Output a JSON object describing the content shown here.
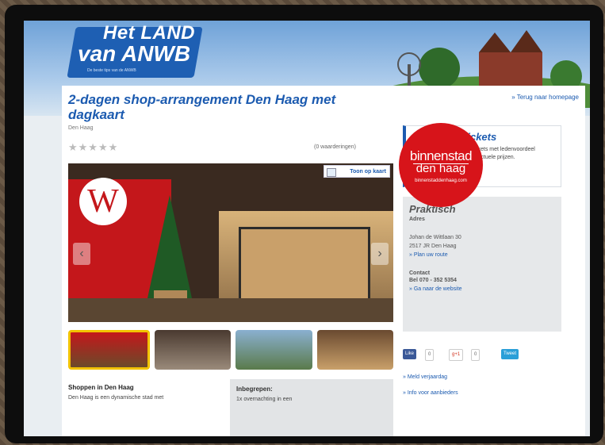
{
  "logo": {
    "line1": "Het LAND",
    "line2": "van ANWB",
    "tagline": "De beste tips van de ANWB"
  },
  "badge": {
    "line1": "binnenstad",
    "line2": "den haag",
    "url": "binnenstaddenhaag.com"
  },
  "page": {
    "title": "2-dagen shop-arrangement Den Haag met dagkaart",
    "back_link": "» Terug naar homepage",
    "location": "Den Haag",
    "stars": "★★★★★",
    "reviews": "(0 waarderingen)",
    "map_button": "Toon op kaart",
    "shop_title": "Shoppen in Den Haag",
    "shop_text": "Den Haag is een dynamische stad met",
    "incl_title": "Inbegrepen:",
    "incl_text": "1x overnachting in een"
  },
  "sidebar": {
    "prijzen_title": "Prijzen en tickets",
    "prijzen_text": "Er zijn momenteel geen tickets met ledenvoordeel verkrijgbaar. Kijk",
    "prijzen_link": "hier",
    "prijzen_text2": "voor actuele prijzen.",
    "prakt_title": "Praktisch",
    "adres_label": "Adres",
    "street": "Johan de Wittlaan 30",
    "city": "2517 JR Den Haag",
    "route_link": "» Plan uw route",
    "contact_label": "Contact",
    "tel": "Bel 070 - 352 5354",
    "website_link": "» Ga naar de website",
    "fb": "Like",
    "fb_count": "0",
    "gp": "g+1",
    "gp_count": "0",
    "tw": "Tweet",
    "link1": "» Meld verjaardag",
    "link2": "» Info voor aanbieders"
  }
}
